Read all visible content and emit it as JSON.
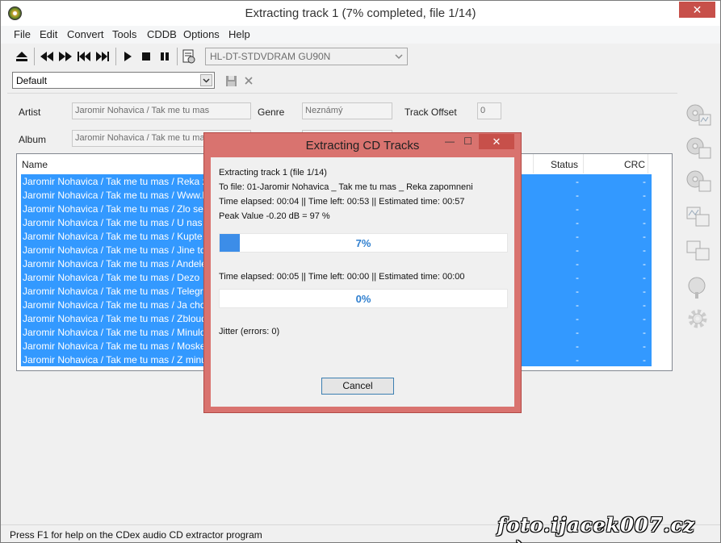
{
  "window": {
    "title": "Extracting track 1 (7% completed, file 1/14)",
    "close_symbol": "✕"
  },
  "menu": [
    "File",
    "Edit",
    "Convert",
    "Tools",
    "CDDB",
    "Options",
    "Help"
  ],
  "toolbar": {
    "drive": "HL-DT-STDVDRAM GU90N",
    "profile": "Default"
  },
  "info": {
    "artist_label": "Artist",
    "artist_value": "Jaromir Nohavica / Tak me tu mas",
    "album_label": "Album",
    "album_value": "Jaromir Nohavica / Tak me tu mas",
    "genre_label": "Genre",
    "genre_value": "Neznámý",
    "track_offset_label": "Track Offset",
    "track_offset_value": "0"
  },
  "tracklist": {
    "columns": {
      "name": "Name",
      "status": "Status",
      "crc": "CRC"
    },
    "rows": [
      {
        "name": "Jaromir Nohavica / Tak me tu mas / Reka zapo",
        "status": "-",
        "crc": "-"
      },
      {
        "name": "Jaromir Nohavica / Tak me tu mas / Www.ldne",
        "status": "-",
        "crc": "-"
      },
      {
        "name": "Jaromir Nohavica / Tak me tu mas / Zlo sedi v",
        "status": "-",
        "crc": "-"
      },
      {
        "name": "Jaromir Nohavica / Tak me tu mas / U nas na s",
        "status": "-",
        "crc": "-"
      },
      {
        "name": "Jaromir Nohavica / Tak me tu mas / Kupte si hr",
        "status": "-",
        "crc": "-"
      },
      {
        "name": "Jaromir Nohavica / Tak me tu mas / Jine to neb",
        "status": "-",
        "crc": "-"
      },
      {
        "name": "Jaromir Nohavica / Tak me tu mas / Andele moj",
        "status": "-",
        "crc": "-"
      },
      {
        "name": "Jaromir Nohavica / Tak me tu mas / Dezo",
        "status": "-",
        "crc": "-"
      },
      {
        "name": "Jaromir Nohavica / Tak me tu mas / Telegram",
        "status": "-",
        "crc": "-"
      },
      {
        "name": "Jaromir Nohavica / Tak me tu mas / Ja chci po",
        "status": "-",
        "crc": "-"
      },
      {
        "name": "Jaromir Nohavica / Tak me tu mas / Zbloudily k",
        "status": "-",
        "crc": "-"
      },
      {
        "name": "Jaromir Nohavica / Tak me tu mas / Minulost",
        "status": "-",
        "crc": "-"
      },
      {
        "name": "Jaromir Nohavica / Tak me tu mas / Moskevska",
        "status": "-",
        "crc": "-"
      },
      {
        "name": "Jaromir Nohavica / Tak me tu mas / Z  minula d",
        "status": "-",
        "crc": "-"
      }
    ]
  },
  "dialog": {
    "title": "Extracting CD Tracks",
    "line1": "Extracting track 1 (file 1/14)",
    "line2": "To file: 01-Jaromir Nohavica _ Tak me tu mas _ Reka zapomneni",
    "line3": "Time elapsed: 00:04 || Time left: 00:53 || Estimated time: 00:57",
    "line4": "Peak Value -0.20 dB =  97 %",
    "progress1_label": "7%",
    "progress1_fraction": 0.07,
    "line5": "Time elapsed: 00:05 || Time left: 00:00 || Estimated time: 00:00",
    "progress2_label": "0%",
    "progress2_fraction": 0.0,
    "jitter": "Jitter (errors: 0)",
    "cancel_label": "Cancel",
    "close_symbol": "✕",
    "minimize_symbol": "—",
    "maximize_symbol": "☐"
  },
  "status": {
    "text": "Press F1 for help on the CDex audio CD extractor program"
  },
  "watermark": "foto.ijacek007.cz :-)",
  "colors": {
    "selection": "#3399ff",
    "dialog_frame": "#d9736f",
    "close_button": "#c7504a",
    "progress_fill": "#3c8de8"
  }
}
